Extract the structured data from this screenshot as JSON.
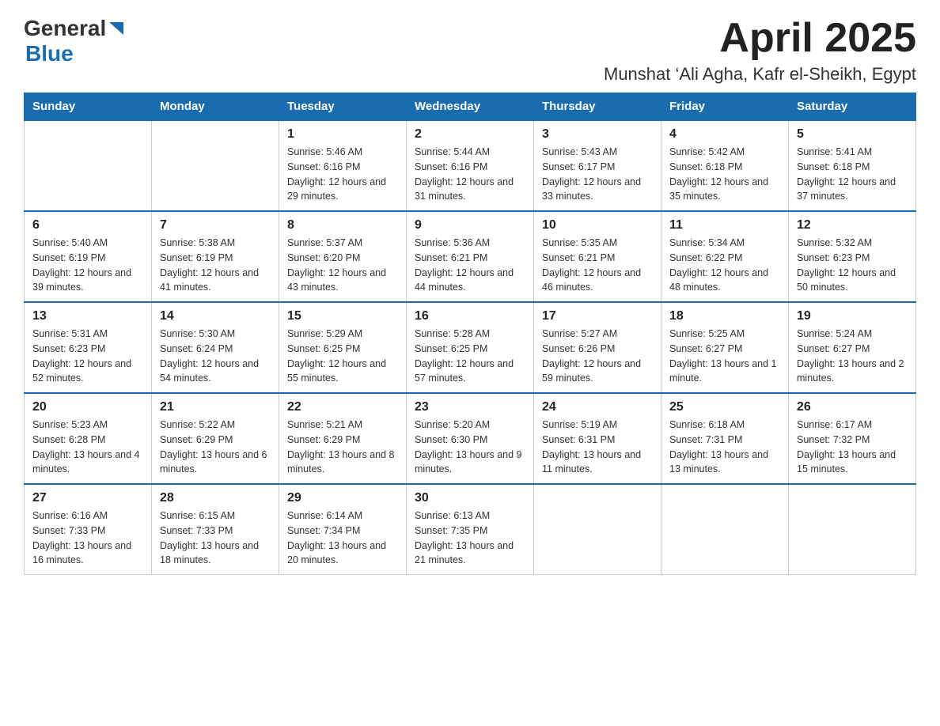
{
  "header": {
    "logo": {
      "text_general": "General",
      "text_blue": "Blue",
      "triangle": "▶"
    },
    "title": "April 2025",
    "location": "Munshat ‘Ali Agha, Kafr el-Sheikh, Egypt"
  },
  "calendar": {
    "days_of_week": [
      "Sunday",
      "Monday",
      "Tuesday",
      "Wednesday",
      "Thursday",
      "Friday",
      "Saturday"
    ],
    "weeks": [
      {
        "cells": [
          {
            "day": "",
            "info": ""
          },
          {
            "day": "",
            "info": ""
          },
          {
            "day": "1",
            "info": "Sunrise: 5:46 AM\nSunset: 6:16 PM\nDaylight: 12 hours\nand 29 minutes."
          },
          {
            "day": "2",
            "info": "Sunrise: 5:44 AM\nSunset: 6:16 PM\nDaylight: 12 hours\nand 31 minutes."
          },
          {
            "day": "3",
            "info": "Sunrise: 5:43 AM\nSunset: 6:17 PM\nDaylight: 12 hours\nand 33 minutes."
          },
          {
            "day": "4",
            "info": "Sunrise: 5:42 AM\nSunset: 6:18 PM\nDaylight: 12 hours\nand 35 minutes."
          },
          {
            "day": "5",
            "info": "Sunrise: 5:41 AM\nSunset: 6:18 PM\nDaylight: 12 hours\nand 37 minutes."
          }
        ]
      },
      {
        "cells": [
          {
            "day": "6",
            "info": "Sunrise: 5:40 AM\nSunset: 6:19 PM\nDaylight: 12 hours\nand 39 minutes."
          },
          {
            "day": "7",
            "info": "Sunrise: 5:38 AM\nSunset: 6:19 PM\nDaylight: 12 hours\nand 41 minutes."
          },
          {
            "day": "8",
            "info": "Sunrise: 5:37 AM\nSunset: 6:20 PM\nDaylight: 12 hours\nand 43 minutes."
          },
          {
            "day": "9",
            "info": "Sunrise: 5:36 AM\nSunset: 6:21 PM\nDaylight: 12 hours\nand 44 minutes."
          },
          {
            "day": "10",
            "info": "Sunrise: 5:35 AM\nSunset: 6:21 PM\nDaylight: 12 hours\nand 46 minutes."
          },
          {
            "day": "11",
            "info": "Sunrise: 5:34 AM\nSunset: 6:22 PM\nDaylight: 12 hours\nand 48 minutes."
          },
          {
            "day": "12",
            "info": "Sunrise: 5:32 AM\nSunset: 6:23 PM\nDaylight: 12 hours\nand 50 minutes."
          }
        ]
      },
      {
        "cells": [
          {
            "day": "13",
            "info": "Sunrise: 5:31 AM\nSunset: 6:23 PM\nDaylight: 12 hours\nand 52 minutes."
          },
          {
            "day": "14",
            "info": "Sunrise: 5:30 AM\nSunset: 6:24 PM\nDaylight: 12 hours\nand 54 minutes."
          },
          {
            "day": "15",
            "info": "Sunrise: 5:29 AM\nSunset: 6:25 PM\nDaylight: 12 hours\nand 55 minutes."
          },
          {
            "day": "16",
            "info": "Sunrise: 5:28 AM\nSunset: 6:25 PM\nDaylight: 12 hours\nand 57 minutes."
          },
          {
            "day": "17",
            "info": "Sunrise: 5:27 AM\nSunset: 6:26 PM\nDaylight: 12 hours\nand 59 minutes."
          },
          {
            "day": "18",
            "info": "Sunrise: 5:25 AM\nSunset: 6:27 PM\nDaylight: 13 hours\nand 1 minute."
          },
          {
            "day": "19",
            "info": "Sunrise: 5:24 AM\nSunset: 6:27 PM\nDaylight: 13 hours\nand 2 minutes."
          }
        ]
      },
      {
        "cells": [
          {
            "day": "20",
            "info": "Sunrise: 5:23 AM\nSunset: 6:28 PM\nDaylight: 13 hours\nand 4 minutes."
          },
          {
            "day": "21",
            "info": "Sunrise: 5:22 AM\nSunset: 6:29 PM\nDaylight: 13 hours\nand 6 minutes."
          },
          {
            "day": "22",
            "info": "Sunrise: 5:21 AM\nSunset: 6:29 PM\nDaylight: 13 hours\nand 8 minutes."
          },
          {
            "day": "23",
            "info": "Sunrise: 5:20 AM\nSunset: 6:30 PM\nDaylight: 13 hours\nand 9 minutes."
          },
          {
            "day": "24",
            "info": "Sunrise: 5:19 AM\nSunset: 6:31 PM\nDaylight: 13 hours\nand 11 minutes."
          },
          {
            "day": "25",
            "info": "Sunrise: 6:18 AM\nSunset: 7:31 PM\nDaylight: 13 hours\nand 13 minutes."
          },
          {
            "day": "26",
            "info": "Sunrise: 6:17 AM\nSunset: 7:32 PM\nDaylight: 13 hours\nand 15 minutes."
          }
        ]
      },
      {
        "cells": [
          {
            "day": "27",
            "info": "Sunrise: 6:16 AM\nSunset: 7:33 PM\nDaylight: 13 hours\nand 16 minutes."
          },
          {
            "day": "28",
            "info": "Sunrise: 6:15 AM\nSunset: 7:33 PM\nDaylight: 13 hours\nand 18 minutes."
          },
          {
            "day": "29",
            "info": "Sunrise: 6:14 AM\nSunset: 7:34 PM\nDaylight: 13 hours\nand 20 minutes."
          },
          {
            "day": "30",
            "info": "Sunrise: 6:13 AM\nSunset: 7:35 PM\nDaylight: 13 hours\nand 21 minutes."
          },
          {
            "day": "",
            "info": ""
          },
          {
            "day": "",
            "info": ""
          },
          {
            "day": "",
            "info": ""
          }
        ]
      }
    ]
  }
}
